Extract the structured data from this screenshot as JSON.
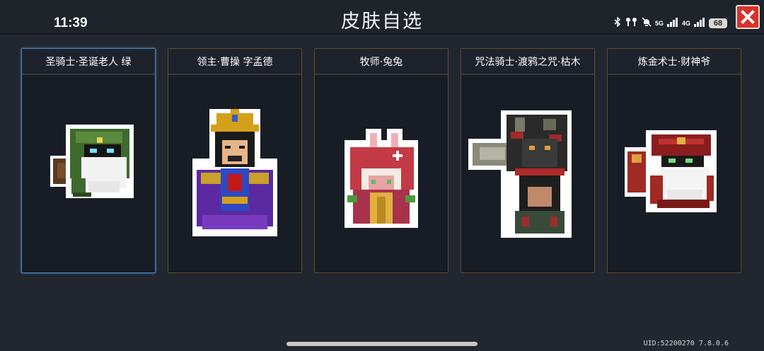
{
  "status_bar": {
    "time": "11:39",
    "network_5g": "5G",
    "network_4g": "4G",
    "battery": "68",
    "icons": [
      "bluetooth-icon",
      "earbuds-icon",
      "mute-bell-icon",
      "signal-icon",
      "signal-icon",
      "battery-icon"
    ]
  },
  "header": {
    "title": "皮肤自选"
  },
  "close_icon": "close-icon",
  "skins": [
    {
      "label": "圣骑士·圣诞老人 绿",
      "selected": true,
      "art": "green-santa-knight-sprite"
    },
    {
      "label": "领主·曹操 字孟德",
      "selected": false,
      "art": "cao-cao-lord-sprite"
    },
    {
      "label": "牧师·兔兔",
      "selected": false,
      "art": "bunny-priest-sprite"
    },
    {
      "label": "咒法骑士·渡鸦之咒·枯木",
      "selected": false,
      "art": "raven-curse-knight-sprite"
    },
    {
      "label": "炼金术士·财神爷",
      "selected": false,
      "art": "fortune-god-alchemist-sprite"
    }
  ],
  "footer": {
    "uid": "UID:52200270 7.8.0.6"
  },
  "colors": {
    "background": "#22262e",
    "card_bg": "#181c25",
    "card_border": "#5c4f2b",
    "selected_border": "#4a86c6",
    "close_red": "#d8322c"
  }
}
